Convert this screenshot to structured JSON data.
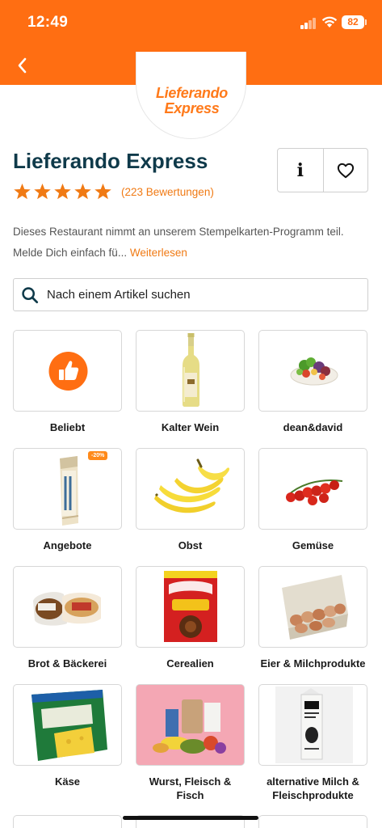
{
  "status": {
    "time": "12:49",
    "battery": "82"
  },
  "brand": {
    "logo_line1": "Lieferando",
    "logo_line2": "Express"
  },
  "restaurant": {
    "name": "Lieferando Express",
    "rating": 5,
    "reviews": "(223 Bewertungen)",
    "description": "Dieses Restaurant nimmt an unserem Stempelkarten-Programm teil. Melde Dich einfach fü...",
    "read_more": "Weiterlesen",
    "info_label": "i"
  },
  "search": {
    "placeholder": "Nach einem Artikel suchen"
  },
  "colors": {
    "brand_orange": "#ff6e12",
    "title_navy": "#0f3a4a",
    "link_orange": "#f07a14"
  },
  "categories": [
    {
      "label": "Beliebt",
      "icon": "thumbs-up-icon"
    },
    {
      "label": "Kalter Wein",
      "icon": "wine-bottle-icon"
    },
    {
      "label": "dean&david",
      "icon": "salad-bowl-icon"
    },
    {
      "label": "Angebote",
      "icon": "offer-product-icon",
      "badge": "-20%"
    },
    {
      "label": "Obst",
      "icon": "banana-icon"
    },
    {
      "label": "Gemüse",
      "icon": "tomato-icon"
    },
    {
      "label": "Brot & Bäckerei",
      "icon": "bread-icon"
    },
    {
      "label": "Cerealien",
      "icon": "cereal-box-icon"
    },
    {
      "label": "Eier & Milchprodukte",
      "icon": "egg-carton-icon"
    },
    {
      "label": "Käse",
      "icon": "cheese-pack-icon"
    },
    {
      "label": "Wurst, Fleisch & Fisch",
      "icon": "groceries-icon"
    },
    {
      "label": "alternative Milch & Fleischprodukte",
      "icon": "oat-milk-carton-icon"
    }
  ]
}
